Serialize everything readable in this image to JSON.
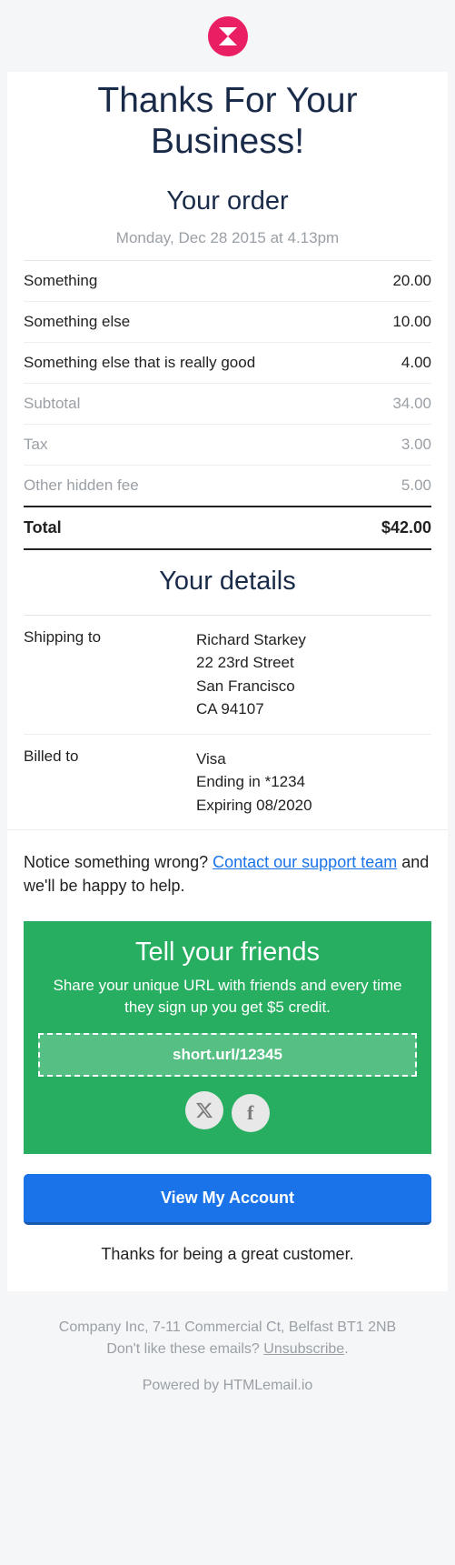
{
  "logo_icon": "hourglass-icon",
  "heading": "Thanks For Your Business!",
  "order_heading": "Your order",
  "order_date": "Monday, Dec 28 2015 at 4.13pm",
  "items": [
    {
      "label": "Something",
      "price": "20.00"
    },
    {
      "label": "Something else",
      "price": "10.00"
    },
    {
      "label": "Something else that is really good",
      "price": "4.00"
    }
  ],
  "fees": [
    {
      "label": "Subtotal",
      "price": "34.00"
    },
    {
      "label": "Tax",
      "price": "3.00"
    },
    {
      "label": "Other hidden fee",
      "price": "5.00"
    }
  ],
  "total_label": "Total",
  "total_price": "$42.00",
  "details_heading": "Your details",
  "shipping_label": "Shipping to",
  "shipping": {
    "name": "Richard Starkey",
    "street": "22 23rd Street",
    "city": "San Francisco",
    "region": "CA 94107"
  },
  "billed_label": "Billed to",
  "billed": {
    "card": "Visa",
    "ending": "Ending in *1234",
    "expiring": "Expiring 08/2020"
  },
  "notice_pre": "Notice something wrong? ",
  "notice_link": "Contact our support team",
  "notice_post": " and we'll be happy to help.",
  "share": {
    "heading": "Tell your friends",
    "body": "Share your unique URL with friends and every time they sign up you get $5 credit.",
    "url": "short.url/12345"
  },
  "cta_label": "View My Account",
  "closing": "Thanks for being a great customer.",
  "footer": {
    "company": "Company Inc, 7-11 Commercial Ct, Belfast BT1 2NB",
    "unsub_pre": "Don't like these emails? ",
    "unsub_link": "Unsubscribe",
    "unsub_post": ".",
    "powered": "Powered by HTMLemail.io"
  }
}
